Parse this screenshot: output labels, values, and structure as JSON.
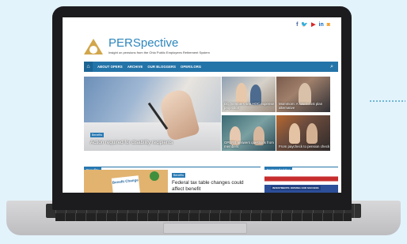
{
  "site": {
    "brand": "PERSpective",
    "tagline": "Insight on pensions from the Ohio Public Employees Retirement System",
    "social_icons": [
      "facebook-icon",
      "twitter-icon",
      "youtube-icon",
      "linkedin-icon",
      "rss-icon"
    ]
  },
  "nav": {
    "items": [
      "ABOUT OPERS",
      "ARCHIVE",
      "OUR BLOGGERS",
      "OPERS.ORG"
    ]
  },
  "hero": {
    "tag": "Benefits",
    "title": "Action required for disability recipients"
  },
  "thumbnails": [
    {
      "title": "DC members see HOC expense projection"
    },
    {
      "title": "Mommom: A lower-cost plan alternative"
    },
    {
      "title": "OPERS answers questions from members"
    },
    {
      "title": "From paycheck to pension check"
    }
  ],
  "sections": {
    "benefits": "Benefits",
    "featured_video": "Featured Video"
  },
  "benefit_article": {
    "image_note": "Benefit Change",
    "tag": "Benefits",
    "title": "Federal tax table changes could affect benefit"
  },
  "video": {
    "caption": "INVESTMENTS: DRIVING OUR SUCCESS"
  },
  "colors": {
    "primary": "#2374a8",
    "brand_text": "#2c86bd",
    "logo_gold": "#d2a64a"
  }
}
